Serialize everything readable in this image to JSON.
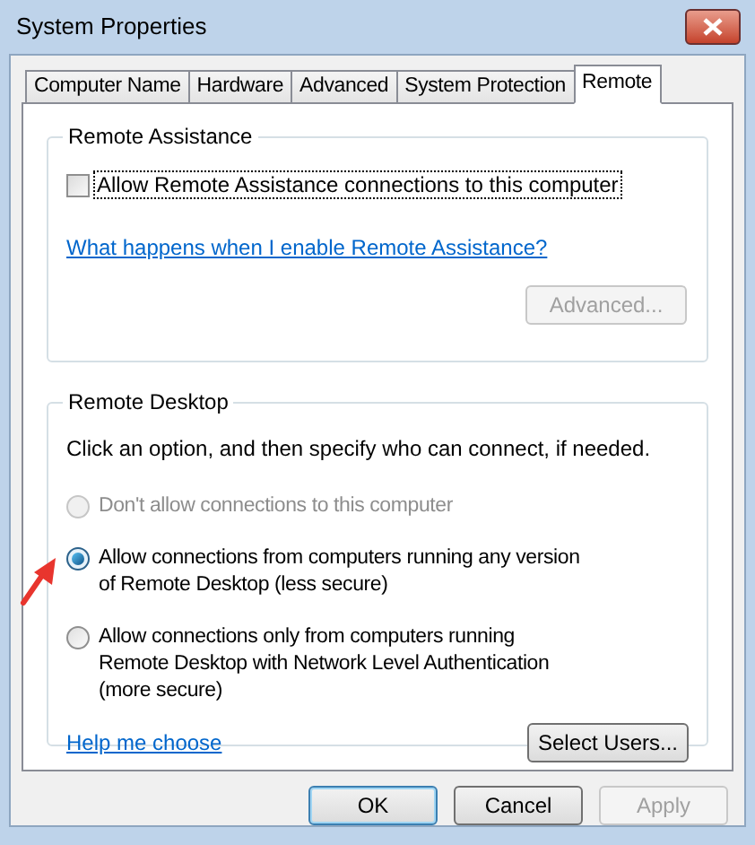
{
  "window": {
    "title": "System Properties"
  },
  "tabs": [
    {
      "label": "Computer Name",
      "selected": false
    },
    {
      "label": "Hardware",
      "selected": false
    },
    {
      "label": "Advanced",
      "selected": false
    },
    {
      "label": "System Protection",
      "selected": false
    },
    {
      "label": "Remote",
      "selected": true
    }
  ],
  "remote_assistance": {
    "title": "Remote Assistance",
    "checkbox": {
      "label": "Allow Remote Assistance connections to this computer",
      "checked": false
    },
    "link": "What happens when I enable Remote Assistance?",
    "button": {
      "label": "Advanced...",
      "disabled": true
    }
  },
  "remote_desktop": {
    "title": "Remote Desktop",
    "instruction": "Click an option, and then specify who can connect, if needed.",
    "options": [
      {
        "label": "Don't allow connections to this computer",
        "selected": false,
        "disabled": true
      },
      {
        "label": "Allow connections from computers running any version of Remote Desktop (less secure)",
        "selected": true,
        "disabled": false,
        "pointer": true
      },
      {
        "label": "Allow connections only from computers running Remote Desktop with Network Level Authentication (more secure)",
        "selected": false,
        "disabled": false
      }
    ],
    "link": "Help me choose",
    "button": {
      "label": "Select Users...",
      "disabled": false
    }
  },
  "buttons": [
    {
      "label": "OK",
      "default": true,
      "disabled": false
    },
    {
      "label": "Cancel",
      "default": false,
      "disabled": false
    },
    {
      "label": "Apply",
      "default": false,
      "disabled": true
    }
  ]
}
